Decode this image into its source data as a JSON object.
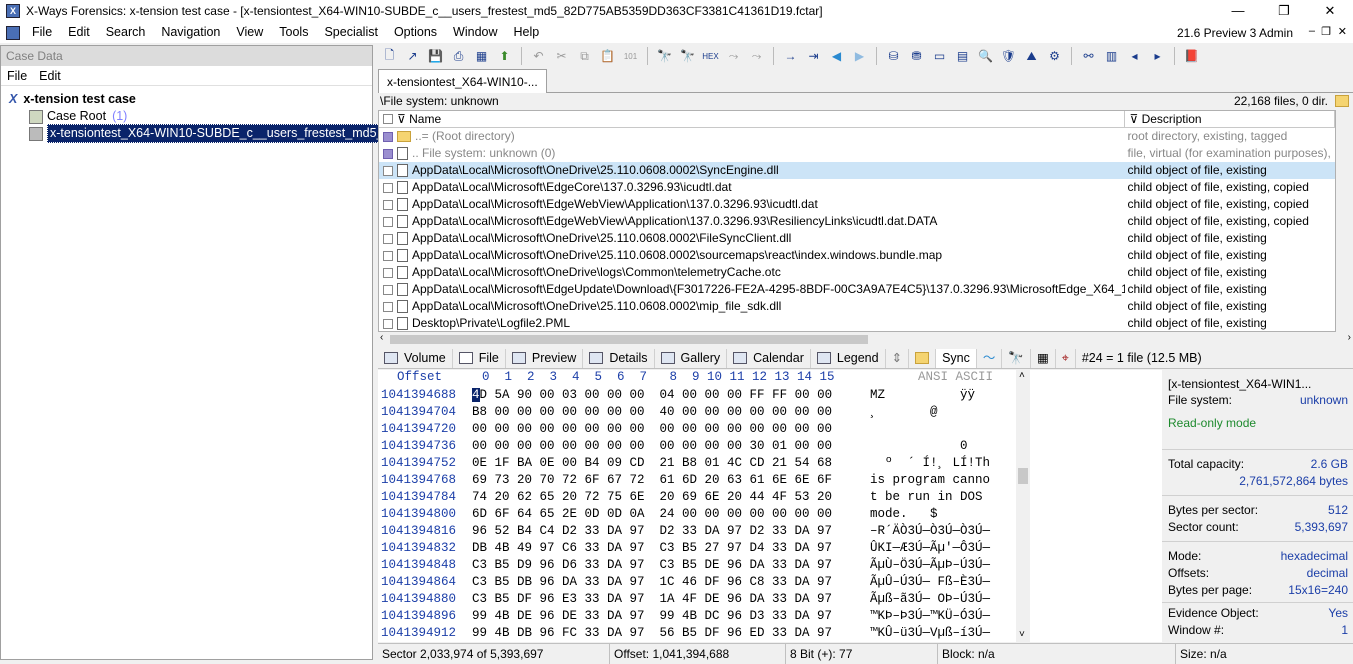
{
  "window": {
    "title": "X-Ways Forensics: x-tension test case - [x-tensiontest_X64-WIN10-SUBDE_c__users_frestest_md5_82D775AB5359DD363CF3381C41361D19.fctar]",
    "min": "—",
    "max": "❐",
    "close": "✕"
  },
  "menu": {
    "items": [
      "File",
      "Edit",
      "Search",
      "Navigation",
      "View",
      "Tools",
      "Specialist",
      "Options",
      "Window",
      "Help"
    ],
    "version": "21.6 Preview 3 Admin"
  },
  "case": {
    "header": "Case Data",
    "menu": [
      "File",
      "Edit"
    ],
    "root_title": "x-tension test case",
    "case_root": "Case Root",
    "case_root_count": "(1)",
    "evidence": "x-tensiontest_X64-WIN10-SUBDE_c__users_frestest_md5_82D7"
  },
  "tab": {
    "label": "x-tensiontest_X64-WIN10-..."
  },
  "path": {
    "text": "\\File system: unknown",
    "count": "22,168 files, 0 dir."
  },
  "filelist": {
    "columns": [
      "Name",
      "Description"
    ],
    "rows": [
      {
        "name": "..=  (Root directory)",
        "desc": "root directory, existing, tagged",
        "dim": true,
        "tag": true,
        "folder": true
      },
      {
        "name": "..  File system: unknown (0)",
        "desc": "file, virtual (for examination purposes),",
        "dim": true,
        "tag": true
      },
      {
        "name": "AppData\\Local\\Microsoft\\OneDrive\\25.110.0608.0002\\SyncEngine.dll",
        "desc": "child object of file, existing",
        "sel": true
      },
      {
        "name": "AppData\\Local\\Microsoft\\EdgeCore\\137.0.3296.93\\icudtl.dat",
        "desc": "child object of file, existing, copied"
      },
      {
        "name": "AppData\\Local\\Microsoft\\EdgeWebView\\Application\\137.0.3296.93\\icudtl.dat",
        "desc": "child object of file, existing, copied"
      },
      {
        "name": "AppData\\Local\\Microsoft\\EdgeWebView\\Application\\137.0.3296.93\\ResiliencyLinks\\icudtl.dat.DATA",
        "desc": "child object of file, existing, copied"
      },
      {
        "name": "AppData\\Local\\Microsoft\\OneDrive\\25.110.0608.0002\\FileSyncClient.dll",
        "desc": "child object of file, existing"
      },
      {
        "name": "AppData\\Local\\Microsoft\\OneDrive\\25.110.0608.0002\\sourcemaps\\react\\index.windows.bundle.map",
        "desc": "child object of file, existing"
      },
      {
        "name": "AppData\\Local\\Microsoft\\OneDrive\\logs\\Common\\telemetryCache.otc",
        "desc": "child object of file, existing"
      },
      {
        "name": "AppData\\Local\\Microsoft\\EdgeUpdate\\Download\\{F3017226-FE2A-4295-8BDF-00C3A9A7E4C5}\\137.0.3296.93\\MicrosoftEdge_X64_137....",
        "desc": "child object of file, existing"
      },
      {
        "name": "AppData\\Local\\Microsoft\\OneDrive\\25.110.0608.0002\\mip_file_sdk.dll",
        "desc": "child object of file, existing"
      },
      {
        "name": "Desktop\\Private\\Logfile2.PML",
        "desc": "child object of file, existing"
      }
    ]
  },
  "viewtabs": [
    "Volume",
    "File",
    "Preview",
    "Details",
    "Gallery",
    "Calendar",
    "Legend",
    "Sync"
  ],
  "viewtab_status": "#24 = 1 file (12.5 MB)",
  "hex": {
    "offset_label": "Offset",
    "cols": "0  1  2  3  4  5  6  7   8  9 10 11 12 13 14 15",
    "ascii_label": "ANSI ASCII",
    "rows": [
      {
        "off": "1041394688",
        "bytes": "4D 5A 90 00 03 00 00 00  04 00 00 00 FF FF 00 00",
        "ascii": "MZ          ÿÿ"
      },
      {
        "off": "1041394704",
        "bytes": "B8 00 00 00 00 00 00 00  40 00 00 00 00 00 00 00",
        "ascii": "¸       @"
      },
      {
        "off": "1041394720",
        "bytes": "00 00 00 00 00 00 00 00  00 00 00 00 00 00 00 00",
        "ascii": ""
      },
      {
        "off": "1041394736",
        "bytes": "00 00 00 00 00 00 00 00  00 00 00 00 30 01 00 00",
        "ascii": "            0"
      },
      {
        "off": "1041394752",
        "bytes": "0E 1F BA 0E 00 B4 09 CD  21 B8 01 4C CD 21 54 68",
        "ascii": "  º  ´ Í!¸ LÍ!Th"
      },
      {
        "off": "1041394768",
        "bytes": "69 73 20 70 72 6F 67 72  61 6D 20 63 61 6E 6E 6F",
        "ascii": "is program canno"
      },
      {
        "off": "1041394784",
        "bytes": "74 20 62 65 20 72 75 6E  20 69 6E 20 44 4F 53 20",
        "ascii": "t be run in DOS"
      },
      {
        "off": "1041394800",
        "bytes": "6D 6F 64 65 2E 0D 0D 0A  24 00 00 00 00 00 00 00",
        "ascii": "mode.   $"
      },
      {
        "off": "1041394816",
        "bytes": "96 52 B4 C4 D2 33 DA 97  D2 33 DA 97 D2 33 DA 97",
        "ascii": "–R´ÄÒ3Ú—Ò3Ú—Ò3Ú—"
      },
      {
        "off": "1041394832",
        "bytes": "DB 4B 49 97 C6 33 DA 97  C3 B5 27 97 D4 33 DA 97",
        "ascii": "ÛKI—Æ3Ú—Ãµ'—Ô3Ú—"
      },
      {
        "off": "1041394848",
        "bytes": "C3 B5 D9 96 D6 33 DA 97  C3 B5 DE 96 DA 33 DA 97",
        "ascii": "ÃµÙ–Ö3Ú—ÃµÞ–Ú3Ú—"
      },
      {
        "off": "1041394864",
        "bytes": "C3 B5 DB 96 DA 33 DA 97  1C 46 DF 96 C8 33 DA 97",
        "ascii": "ÃµÛ–Ú3Ú— Fß–È3Ú—"
      },
      {
        "off": "1041394880",
        "bytes": "C3 B5 DF 96 E3 33 DA 97  1A 4F DE 96 DA 33 DA 97",
        "ascii": "Ãµß–ã3Ú— OÞ–Ú3Ú—"
      },
      {
        "off": "1041394896",
        "bytes": "99 4B DE 96 DE 33 DA 97  99 4B DC 96 D3 33 DA 97",
        "ascii": "™KÞ–Þ3Ú—™KÜ–Ó3Ú—"
      },
      {
        "off": "1041394912",
        "bytes": "99 4B DB 96 FC 33 DA 97  56 B5 DF 96 ED 33 DA 97",
        "ascii": "™KÛ–ü3Ú—Vµß–í3Ú—"
      }
    ]
  },
  "info": {
    "name": "[x-tensiontest_X64-WIN1...",
    "fs_label": "File system:",
    "fs_value": "unknown",
    "readonly": "Read-only mode",
    "cap_label": "Total capacity:",
    "cap_value": "2.6 GB",
    "cap_bytes": "2,761,572,864 bytes",
    "bps_label": "Bytes per sector:",
    "bps_value": "512",
    "sc_label": "Sector count:",
    "sc_value": "5,393,697",
    "mode_label": "Mode:",
    "mode_value": "hexadecimal",
    "off_label": "Offsets:",
    "off_value": "decimal",
    "bpp_label": "Bytes per page:",
    "bpp_value": "15x16=240",
    "eo_label": "Evidence Object:",
    "eo_value": "Yes",
    "win_label": "Window #:",
    "win_value": "1"
  },
  "status": {
    "sector": "Sector 2,033,974 of 5,393,697",
    "offset": "Offset: 1,041,394,688",
    "bit": "8 Bit (+): 77",
    "block": "Block: n/a",
    "size": "Size: n/a"
  },
  "colors": {
    "selection": "#cce4f7",
    "hexblue": "#1b3ea8",
    "readonly": "#1e8a2e"
  }
}
